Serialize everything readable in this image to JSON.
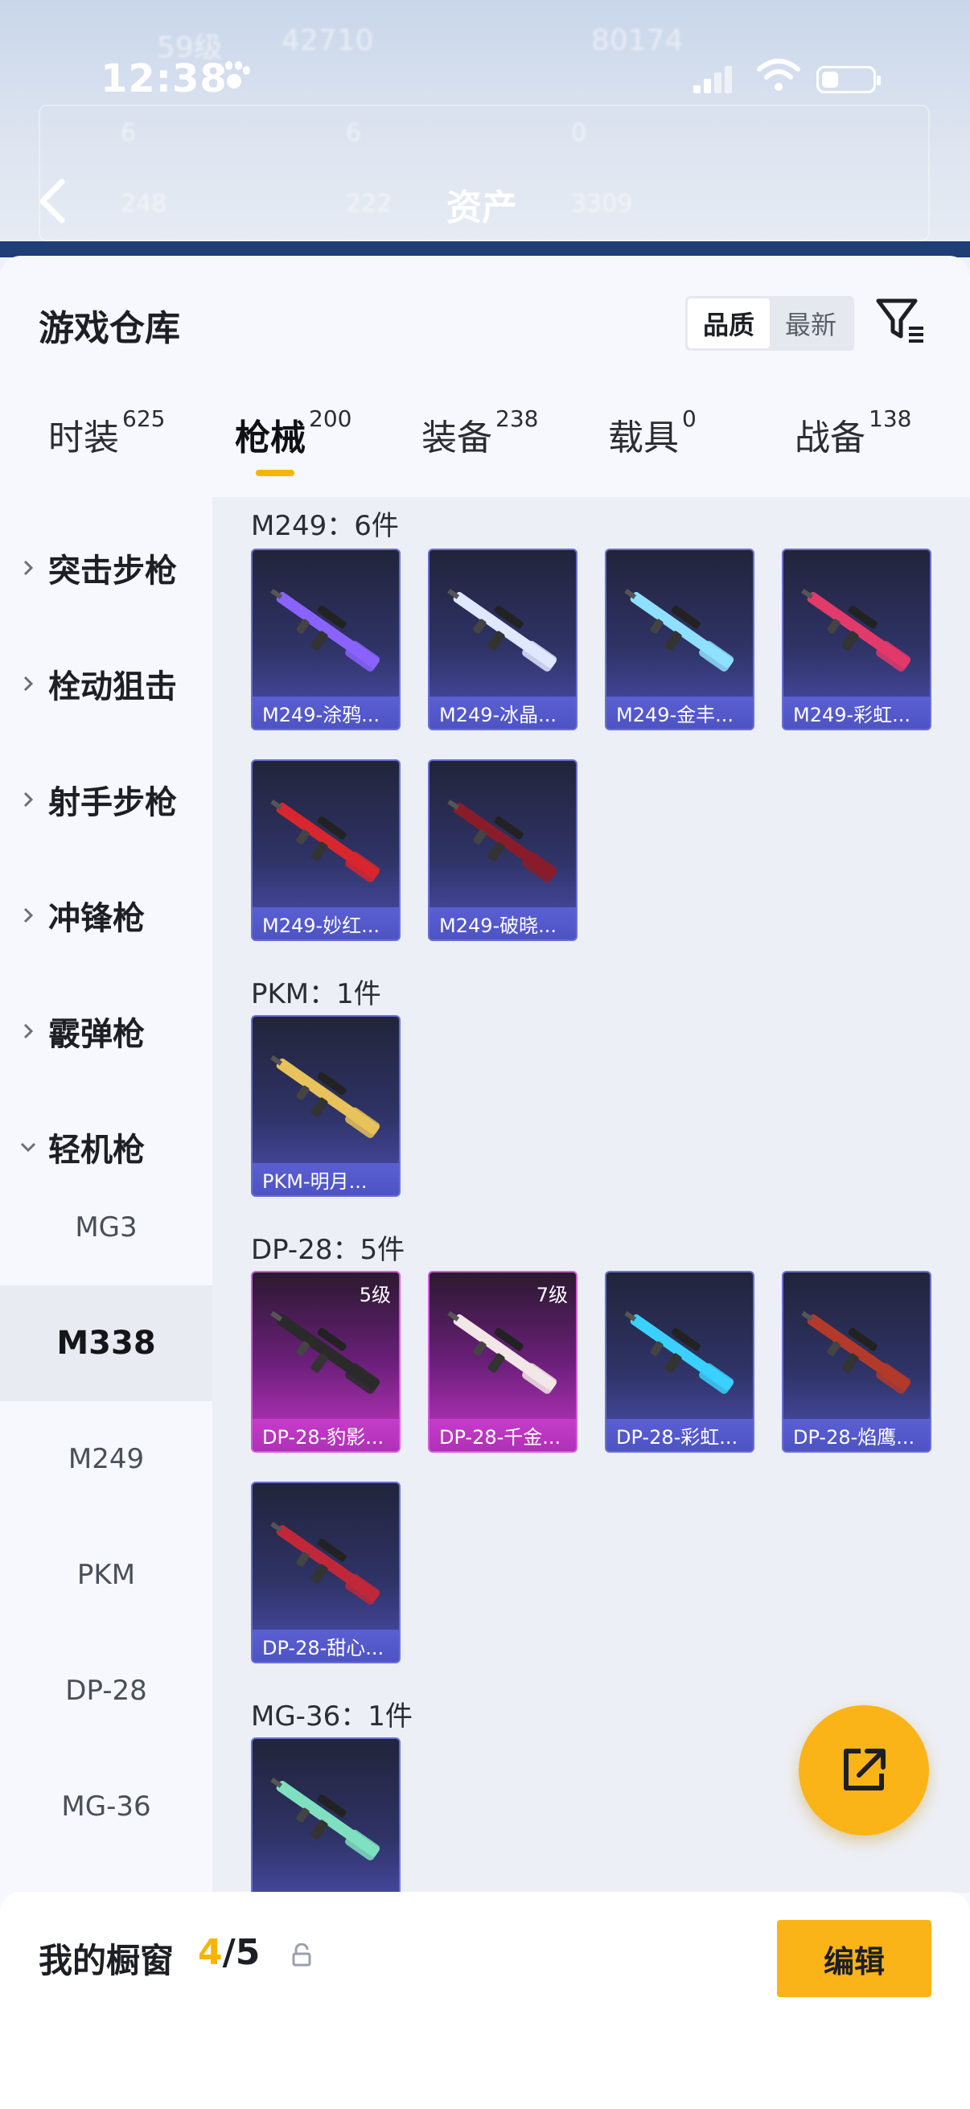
{
  "status_bar": {
    "time": "12:38"
  },
  "background_header": {
    "title": "资产",
    "ghost_texts": [
      "59级",
      "42710",
      "80174",
      "6",
      "6",
      "0",
      "248",
      "222",
      "3309"
    ]
  },
  "sheet": {
    "title": "游戏仓库",
    "sort_options": [
      "品质",
      "最新"
    ],
    "sort_selected": "品质"
  },
  "tabs": [
    {
      "label": "时装",
      "count": "625"
    },
    {
      "label": "枪械",
      "count": "200",
      "active": true
    },
    {
      "label": "装备",
      "count": "238"
    },
    {
      "label": "载具",
      "count": "0"
    },
    {
      "label": "战备",
      "count": "138"
    }
  ],
  "sidebar": {
    "categories": [
      "突击步枪",
      "栓动狙击",
      "射手步枪",
      "冲锋枪",
      "霰弹枪",
      "轻机枪"
    ],
    "sub_items": [
      "MG3",
      "M338",
      "M249",
      "PKM",
      "DP-28",
      "MG-36"
    ],
    "active_sub": "M338"
  },
  "sections": [
    {
      "title": "M249：6件",
      "items": [
        {
          "name": "M249-涂鸦...",
          "color": "#8a63ff"
        },
        {
          "name": "M249-冰晶...",
          "color": "#dfe8ff"
        },
        {
          "name": "M249-金丰...",
          "color": "#8fe0ff"
        },
        {
          "name": "M249-彩虹...",
          "color": "#e23a6a"
        },
        {
          "name": "M249-妙红...",
          "color": "#d8262e"
        },
        {
          "name": "M249-破晓...",
          "color": "#8a1c2a"
        }
      ]
    },
    {
      "title": "PKM：1件",
      "items": [
        {
          "name": "PKM-明月...",
          "color": "#e8c25a"
        }
      ]
    },
    {
      "title": "DP-28：5件",
      "items": [
        {
          "name": "DP-28-豹影...",
          "color": "#2a2a2a",
          "level": "5级",
          "quality": "pink"
        },
        {
          "name": "DP-28-千金...",
          "color": "#f2e6e6",
          "level": "7级",
          "quality": "pink"
        },
        {
          "name": "DP-28-彩虹...",
          "color": "#3ad1ff"
        },
        {
          "name": "DP-28-焰鹰...",
          "color": "#b33a2a"
        },
        {
          "name": "DP-28-甜心...",
          "color": "#c0283a"
        }
      ]
    },
    {
      "title": "MG-36：1件",
      "items": [
        {
          "name": "",
          "color": "#7fe0c0"
        }
      ]
    }
  ],
  "bottom_bar": {
    "title": "我的橱窗",
    "current": "4",
    "total": "/5",
    "edit_label": "编辑"
  },
  "icons": {
    "back": "back-arrow-icon",
    "filter": "filter-icon",
    "fab": "share-external-icon",
    "lock": "lock-icon"
  }
}
